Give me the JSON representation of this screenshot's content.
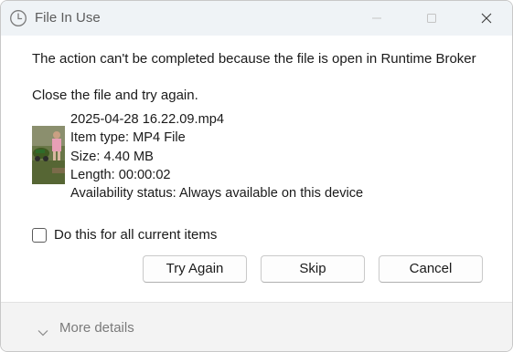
{
  "window": {
    "title": "File In Use",
    "icon": "clock-icon",
    "controls": [
      "minimize-icon",
      "maximize-icon",
      "close-icon"
    ]
  },
  "message": "The action can't be completed because the file is open in Runtime Broker",
  "instruction": "Close the file and try again.",
  "file": {
    "name": "2025-04-28 16.22.09.mp4",
    "type": "Item type: MP4 File",
    "size": "Size: 4.40 MB",
    "length": "Length: 00:00:02",
    "availability": "Availability status: Always available on this device"
  },
  "checkbox": {
    "label": "Do this for all current items",
    "checked": false
  },
  "buttons": {
    "try_again": "Try Again",
    "skip": "Skip",
    "cancel": "Cancel"
  },
  "footer": {
    "more_details": "More details"
  }
}
